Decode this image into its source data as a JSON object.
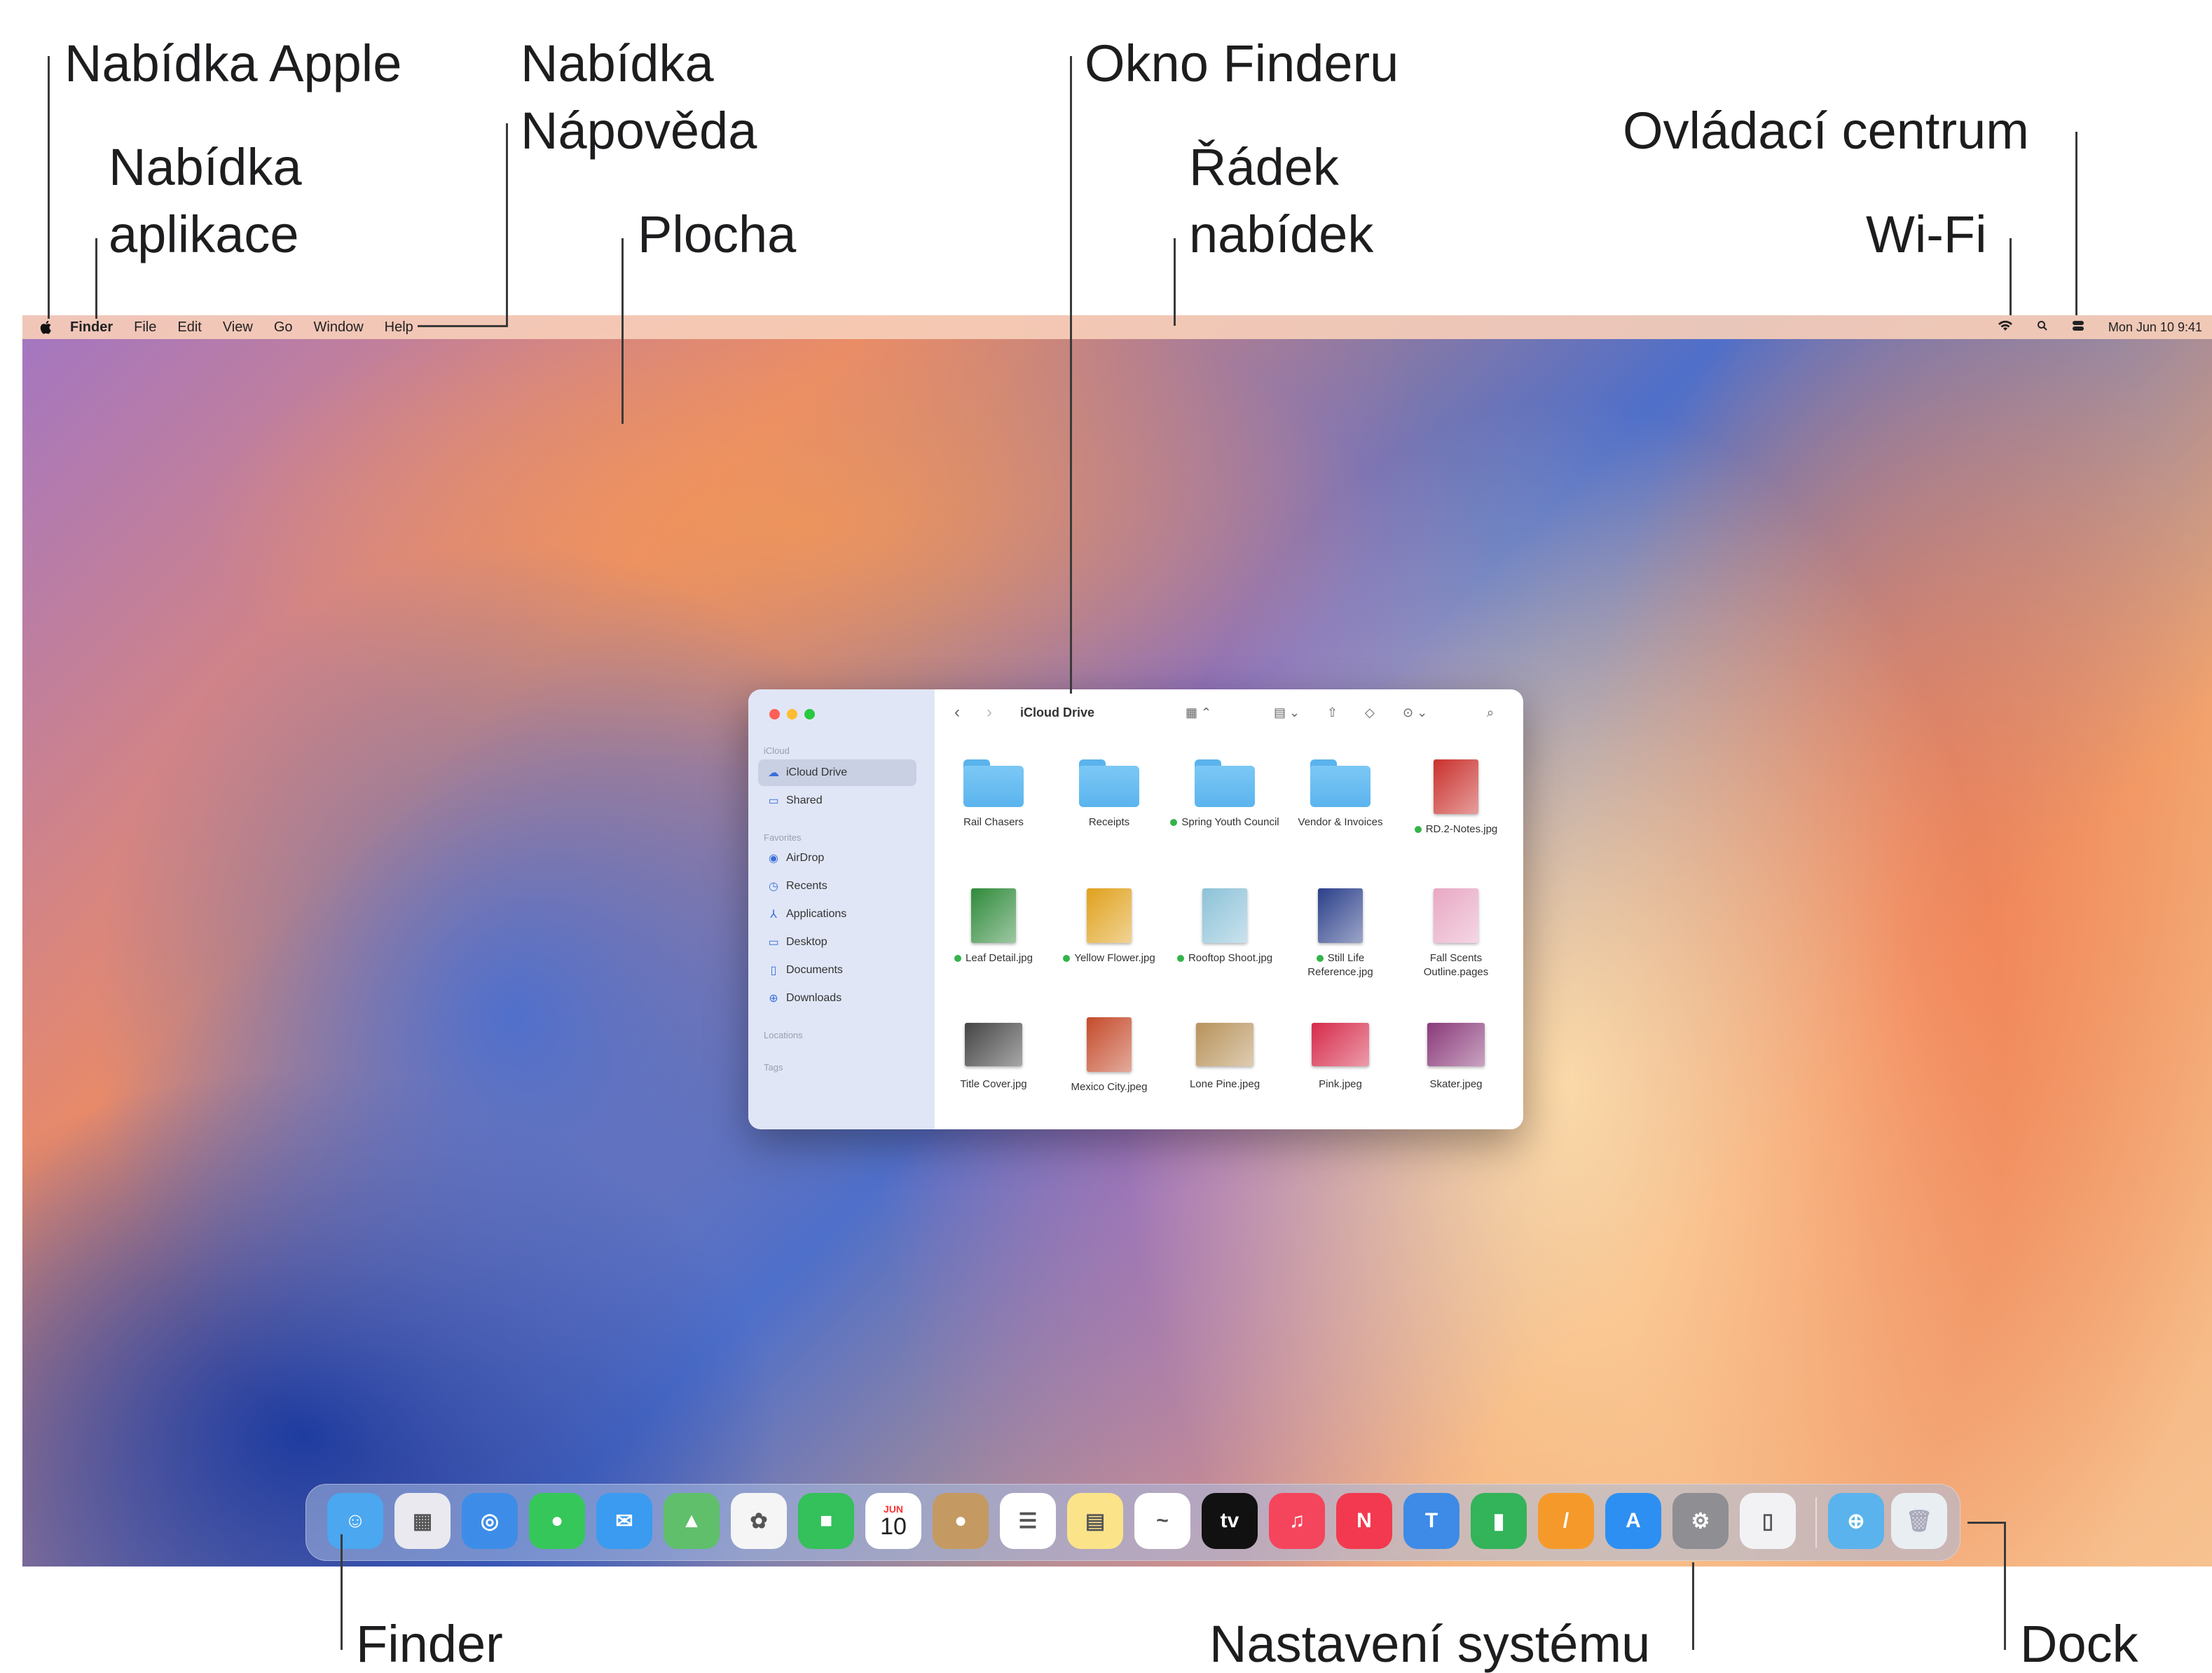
{
  "callouts": {
    "apple_menu": "Nabídka Apple",
    "app_menu_l1": "Nabídka",
    "app_menu_l2": "aplikace",
    "help_menu_l1": "Nabídka",
    "help_menu_l2": "Nápověda",
    "desktop": "Plocha",
    "finder_window": "Okno Finderu",
    "menubar_l1": "Řádek",
    "menubar_l2": "nabídek",
    "control_center": "Ovládací centrum",
    "wifi": "Wi-Fi",
    "finder": "Finder",
    "system_settings": "Nastavení systému",
    "dock": "Dock"
  },
  "menubar": {
    "items": [
      "Finder",
      "File",
      "Edit",
      "View",
      "Go",
      "Window",
      "Help"
    ],
    "datetime": "Mon Jun 10 9:41"
  },
  "finder_window": {
    "title": "iCloud Drive",
    "sidebar": {
      "icloud_header": "iCloud",
      "icloud_items": [
        {
          "label": "iCloud Drive",
          "icon": "cloud-icon"
        },
        {
          "label": "Shared",
          "icon": "shared-folder-icon"
        }
      ],
      "favorites_header": "Favorites",
      "favorite_items": [
        {
          "label": "AirDrop",
          "icon": "airdrop-icon"
        },
        {
          "label": "Recents",
          "icon": "clock-icon"
        },
        {
          "label": "Applications",
          "icon": "applications-icon"
        },
        {
          "label": "Desktop",
          "icon": "desktop-icon"
        },
        {
          "label": "Documents",
          "icon": "document-icon"
        },
        {
          "label": "Downloads",
          "icon": "download-icon"
        }
      ],
      "locations_header": "Locations",
      "tags_header": "Tags"
    },
    "items": [
      {
        "name": "Rail Chasers",
        "kind": "folder",
        "tagged": false
      },
      {
        "name": "Receipts",
        "kind": "folder",
        "tagged": false
      },
      {
        "name": "Spring Youth Council",
        "kind": "folder",
        "tagged": true
      },
      {
        "name": "Vendor & Invoices",
        "kind": "folder",
        "tagged": false
      },
      {
        "name": "RD.2-Notes.jpg",
        "kind": "image",
        "tagged": true,
        "color": "#c9302c"
      },
      {
        "name": "Leaf Detail.jpg",
        "kind": "image",
        "tagged": true,
        "color": "#2f8a3a"
      },
      {
        "name": "Yellow Flower.jpg",
        "kind": "image",
        "tagged": true,
        "color": "#e0a11c"
      },
      {
        "name": "Rooftop Shoot.jpg",
        "kind": "image",
        "tagged": true,
        "color": "#8cc2d8"
      },
      {
        "name": "Still Life Reference.jpg",
        "kind": "image",
        "tagged": true,
        "color": "#2b3f8a"
      },
      {
        "name": "Fall Scents Outline.pages",
        "kind": "image",
        "tagged": false,
        "color": "#e8a8c4"
      },
      {
        "name": "Title Cover.jpg",
        "kind": "image-wide",
        "tagged": false,
        "color": "#444444"
      },
      {
        "name": "Mexico City.jpeg",
        "kind": "image",
        "tagged": false,
        "color": "#c44a2a"
      },
      {
        "name": "Lone Pine.jpeg",
        "kind": "image-wide",
        "tagged": false,
        "color": "#b8925a"
      },
      {
        "name": "Pink.jpeg",
        "kind": "image-wide",
        "tagged": false,
        "color": "#d62a4a"
      },
      {
        "name": "Skater.jpeg",
        "kind": "image-wide",
        "tagged": false,
        "color": "#8a3a7a"
      }
    ]
  },
  "dock": {
    "apps": [
      {
        "name": "finder-icon",
        "color": "#4aa7f0",
        "glyph": "☺"
      },
      {
        "name": "launchpad-icon",
        "color": "#e9e9ef",
        "glyph": "▦"
      },
      {
        "name": "safari-icon",
        "color": "#3d8de8",
        "glyph": "◎"
      },
      {
        "name": "messages-icon",
        "color": "#35c759",
        "glyph": "●"
      },
      {
        "name": "mail-icon",
        "color": "#3a9bf0",
        "glyph": "✉"
      },
      {
        "name": "maps-icon",
        "color": "#5fbf6a",
        "glyph": "▲"
      },
      {
        "name": "photos-icon",
        "color": "#f5f5f5",
        "glyph": "✿"
      },
      {
        "name": "facetime-icon",
        "color": "#34c05a",
        "glyph": "■"
      },
      {
        "name": "calendar-icon",
        "color": "#ffffff",
        "glyph": "10"
      },
      {
        "name": "contacts-icon",
        "color": "#c49a62",
        "glyph": "●"
      },
      {
        "name": "reminders-icon",
        "color": "#ffffff",
        "glyph": "☰"
      },
      {
        "name": "notes-icon",
        "color": "#fbe38a",
        "glyph": "▤"
      },
      {
        "name": "freeform-icon",
        "color": "#ffffff",
        "glyph": "~"
      },
      {
        "name": "tv-icon",
        "color": "#111111",
        "glyph": "tv"
      },
      {
        "name": "music-icon",
        "color": "#f5455c",
        "glyph": "♫"
      },
      {
        "name": "news-icon",
        "color": "#f2394f",
        "glyph": "N"
      },
      {
        "name": "keynote-icon",
        "color": "#3d8be6",
        "glyph": "T"
      },
      {
        "name": "numbers-icon",
        "color": "#33b35a",
        "glyph": "▮"
      },
      {
        "name": "pages-icon",
        "color": "#f59a2a",
        "glyph": "/"
      },
      {
        "name": "app-store-icon",
        "color": "#2d8ff2",
        "glyph": "A"
      },
      {
        "name": "system-settings-icon",
        "color": "#8e8e93",
        "glyph": "⚙"
      },
      {
        "name": "iphone-mirroring-icon",
        "color": "#f2f2f5",
        "glyph": "▯"
      }
    ],
    "folder": {
      "name": "downloads-stack-icon",
      "color": "#5ab3ec"
    },
    "trash": {
      "name": "trash-icon",
      "color": "#e9eef3"
    },
    "calendar_month": "JUN",
    "calendar_day": "10"
  }
}
